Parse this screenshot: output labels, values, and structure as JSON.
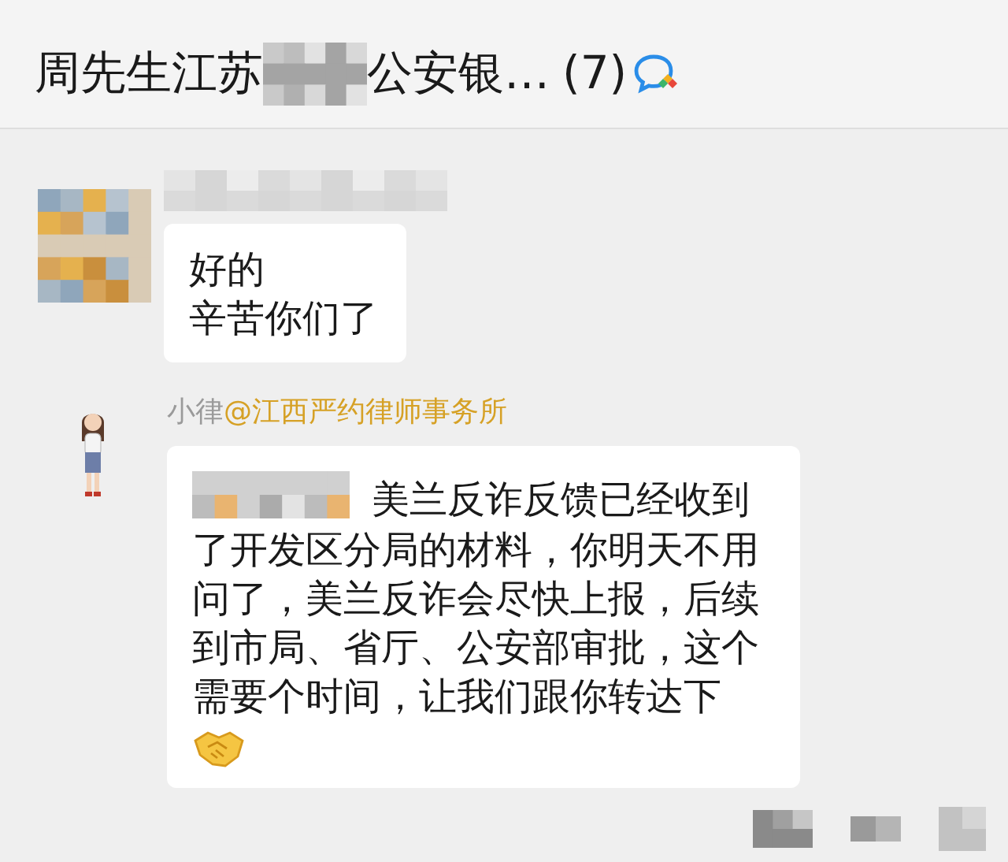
{
  "header": {
    "title_start": "周先生江苏",
    "title_end": "公安银…",
    "count": "(7)"
  },
  "messages": [
    {
      "kind": "hidden-sender",
      "lines": [
        "好的",
        "辛苦你们了"
      ]
    },
    {
      "kind": "named-sender",
      "sender": "小律",
      "org": "@江西严约律师事务所",
      "text": "美兰反诈反馈已经收到了开发区分局的材料，你明天不用问了，美兰反诈会尽快上报，后续到市局、省厅、公安部审批，这个需要个时间，让我们跟你转达下"
    }
  ]
}
